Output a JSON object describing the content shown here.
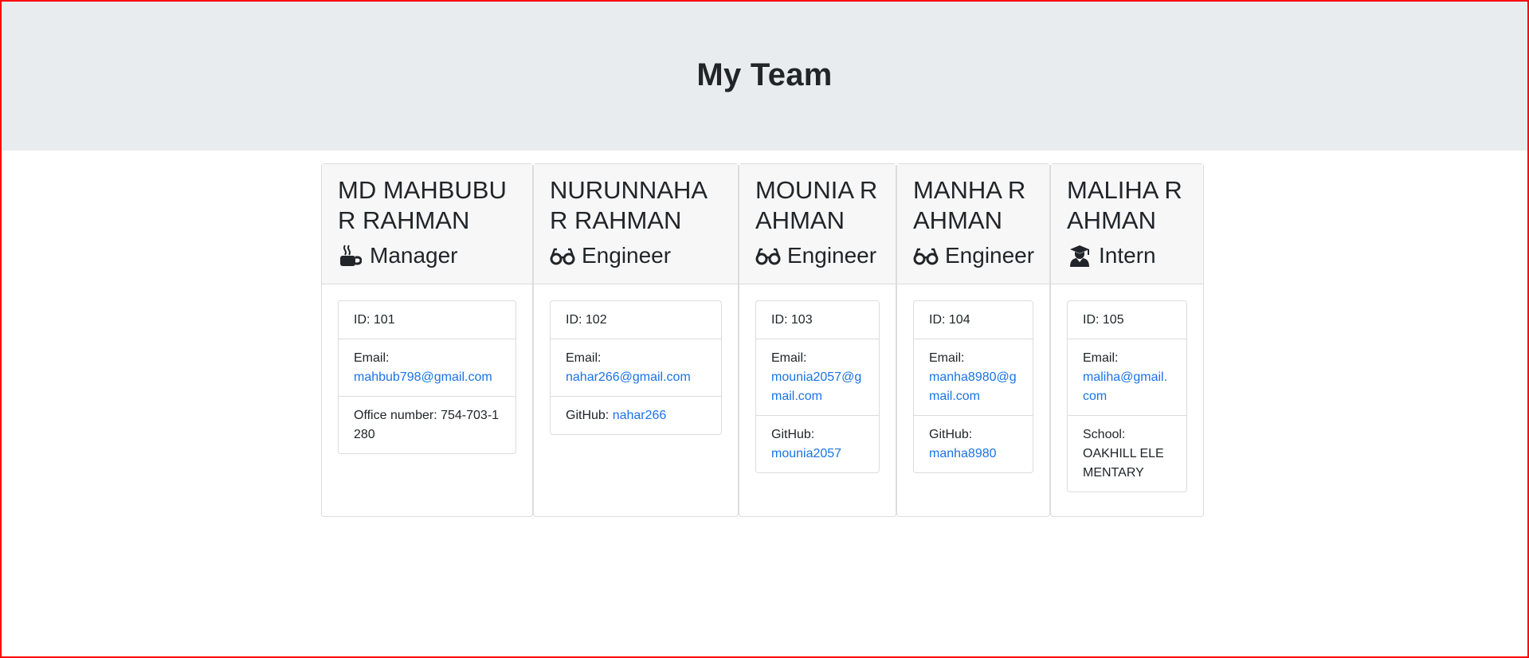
{
  "header": {
    "title": "My Team"
  },
  "employees": [
    {
      "name": "MD MAHBUBUR RAHMAN",
      "role": "Manager",
      "icon": "mug-hot-icon",
      "id_label": "ID: 101",
      "email_label": "Email:",
      "email": "mahbub798@gmail.com",
      "extra_label": "Office number:",
      "extra_value": "754-703-1280"
    },
    {
      "name": "NURUNNAHAR RAHMAN",
      "role": "Engineer",
      "icon": "glasses-icon",
      "id_label": "ID: 102",
      "email_label": "Email:",
      "email": "nahar266@gmail.com",
      "extra_label": "GitHub:",
      "extra_value": "nahar266"
    },
    {
      "name": "MOUNIA RAHMAN",
      "role": "Engineer",
      "icon": "glasses-icon",
      "id_label": "ID: 103",
      "email_label": "Email:",
      "email": "mounia2057@gmail.com",
      "extra_label": "GitHub:",
      "extra_value": "mounia2057"
    },
    {
      "name": "MANHA RAHMAN",
      "role": "Engineer",
      "icon": "glasses-icon",
      "id_label": "ID: 104",
      "email_label": "Email:",
      "email": "manha8980@gmail.com",
      "extra_label": "GitHub:",
      "extra_value": "manha8980"
    },
    {
      "name": "MALIHA RAHMAN",
      "role": "Intern",
      "icon": "user-graduate-icon",
      "id_label": "ID: 105",
      "email_label": "Email:",
      "email": "maliha@gmail.com",
      "extra_label": "School:",
      "extra_value": "OAKHILL ELEMENTARY"
    }
  ],
  "colors": {
    "jumbotron_bg": "#e9ecef",
    "link": "#1a73e8",
    "frame_border": "#ff0000"
  }
}
